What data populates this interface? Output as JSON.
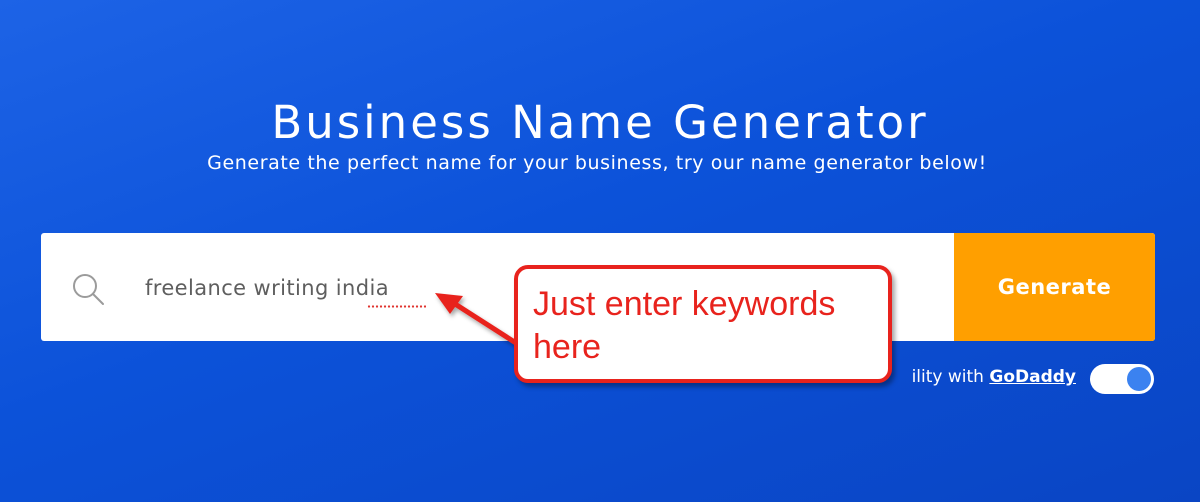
{
  "header": {
    "title": "Business Name Generator",
    "subtitle": "Generate the perfect name for your business, try our name generator below!"
  },
  "search": {
    "value": "freelance writing india",
    "icon": "search-icon"
  },
  "generate_button": {
    "label": "Generate",
    "color": "#ff9f00"
  },
  "availability": {
    "prefix": "ility with",
    "link_label": "GoDaddy",
    "toggle_on": true
  },
  "annotation": {
    "text": "Just enter keywords here",
    "color": "#e8231d"
  },
  "colors": {
    "background": "#0c52d9",
    "toggle_knob": "#3b82f0"
  }
}
